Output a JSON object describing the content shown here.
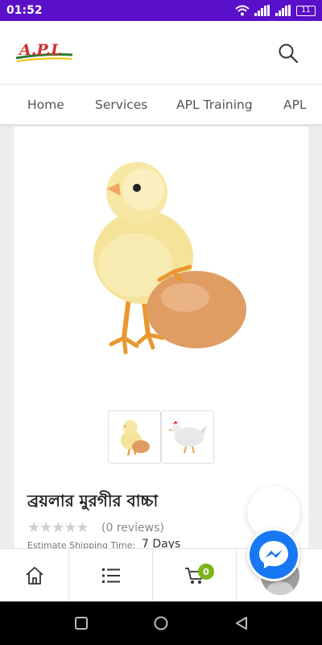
{
  "status_bar": {
    "time": "01:52",
    "battery": "11"
  },
  "header": {
    "logo_text": "A.P.L"
  },
  "nav": {
    "items": [
      "Home",
      "Services",
      "APL Training",
      "APL"
    ]
  },
  "product": {
    "title": "ব্রয়লার মুরগীর বাচ্চা",
    "rating_stars": "★★★★★",
    "rating": 0,
    "reviews": "(0 reviews)",
    "shipping_label": "Estimate Shipping Time:",
    "shipping_value": "7 Days"
  },
  "bottom_nav": {
    "cart_count": "0"
  },
  "colors": {
    "status_bar": "#5a0fc8",
    "badge": "#7cb518",
    "messenger": "#1877f2"
  }
}
